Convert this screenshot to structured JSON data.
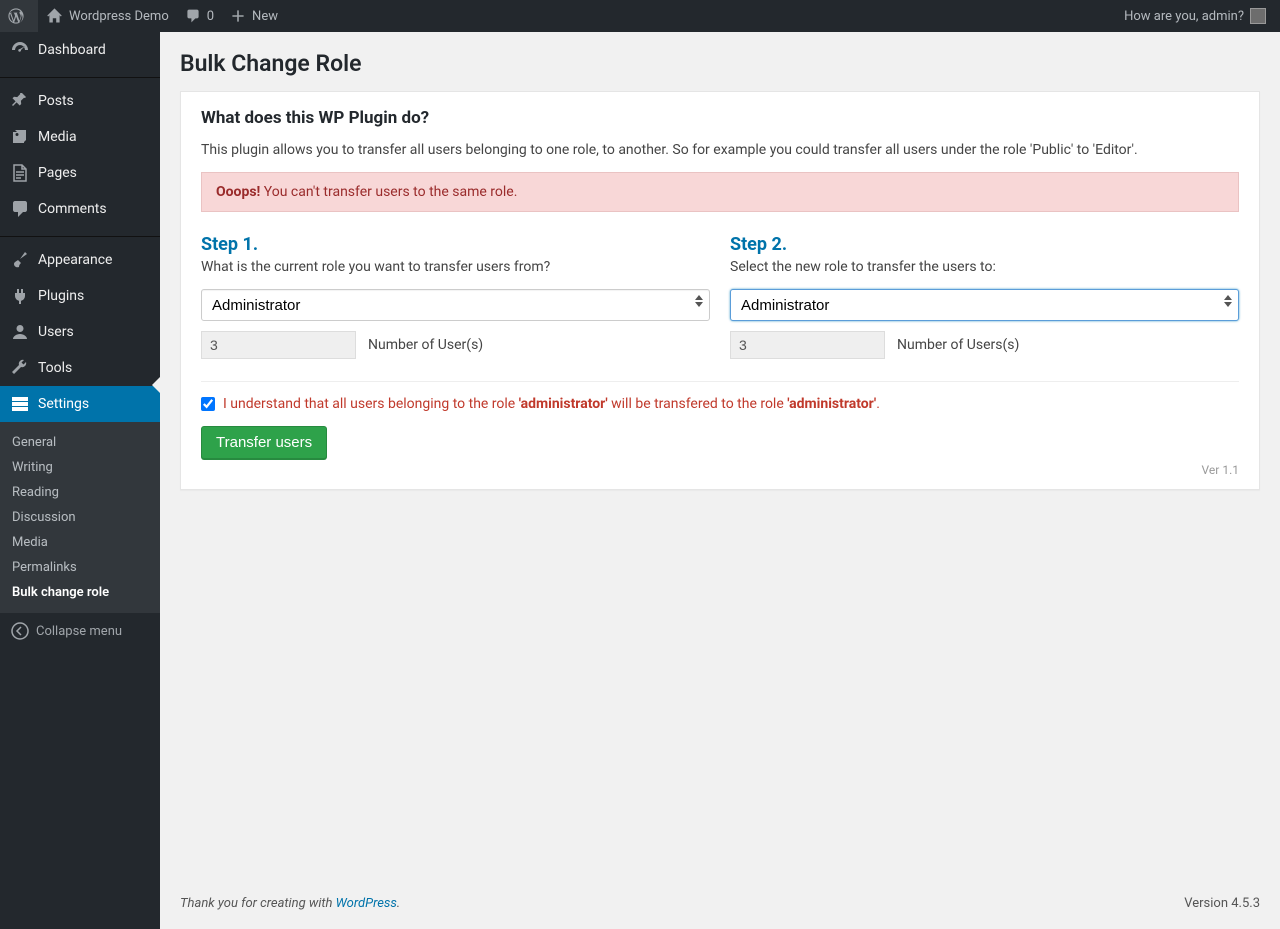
{
  "adminbar": {
    "site_name": "Wordpress Demo",
    "comment_count": "0",
    "new_label": "New",
    "howdy_prefix": "How are you, ",
    "howdy_user": "admin",
    "howdy_suffix": "?"
  },
  "sidebar": {
    "items": [
      {
        "label": "Dashboard",
        "icon": "dashboard"
      },
      {
        "label": "Posts",
        "icon": "pin"
      },
      {
        "label": "Media",
        "icon": "media"
      },
      {
        "label": "Pages",
        "icon": "page"
      },
      {
        "label": "Comments",
        "icon": "comment"
      },
      {
        "label": "Appearance",
        "icon": "brush"
      },
      {
        "label": "Plugins",
        "icon": "plug"
      },
      {
        "label": "Users",
        "icon": "user"
      },
      {
        "label": "Tools",
        "icon": "wrench"
      },
      {
        "label": "Settings",
        "icon": "sliders"
      }
    ],
    "submenu": [
      {
        "label": "General"
      },
      {
        "label": "Writing"
      },
      {
        "label": "Reading"
      },
      {
        "label": "Discussion"
      },
      {
        "label": "Media"
      },
      {
        "label": "Permalinks"
      },
      {
        "label": "Bulk change role"
      }
    ],
    "collapse_label": "Collapse menu"
  },
  "page": {
    "title": "Bulk Change Role",
    "section_heading": "What does this WP Plugin do?",
    "description": "This plugin allows you to transfer all users belonging to one role, to another. So for example you could transfer all users under the role 'Public' to 'Editor'.",
    "error_prefix": "Ooops!",
    "error_msg": "You can't transfer users to the same role.",
    "step1": {
      "title": "Step 1.",
      "question": "What is the current role you want to transfer users from?",
      "selected": "Administrator",
      "count": "3",
      "count_label": "Number of User(s)"
    },
    "step2": {
      "title": "Step 2.",
      "question": "Select the new role to transfer the users to:",
      "selected": "Administrator",
      "count": "3",
      "count_label": "Number of Users(s)"
    },
    "confirm_parts": {
      "p1": "I understand that all users belonging to the role ",
      "r1": "'administrator'",
      "p2": " will be transfered to the role ",
      "r2": "'administrator'",
      "p3": "."
    },
    "confirm_checked": true,
    "submit_label": "Transfer users",
    "version_small": "Ver 1.1"
  },
  "footer": {
    "thanks_prefix": "Thank you for creating with ",
    "thanks_link": "WordPress",
    "thanks_suffix": ".",
    "version": "Version 4.5.3"
  }
}
